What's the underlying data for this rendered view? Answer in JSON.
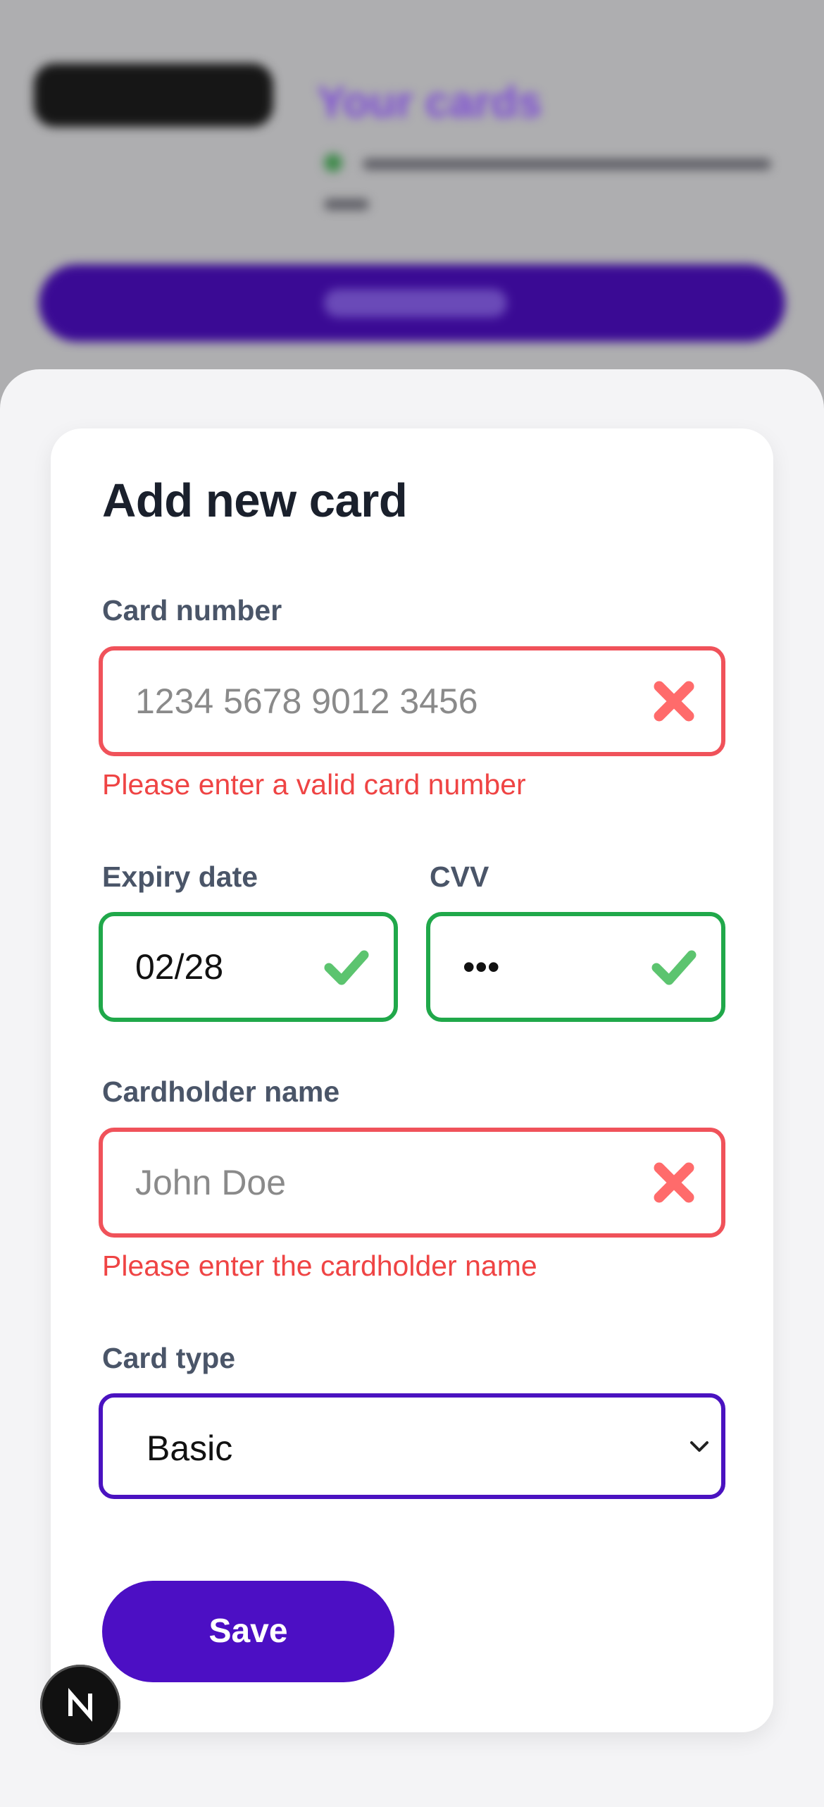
{
  "background": {
    "title": "Your cards"
  },
  "form": {
    "title": "Add new card",
    "card_number": {
      "label": "Card number",
      "placeholder": "1234 5678 9012 3456",
      "value": "",
      "status": "invalid",
      "error": "Please enter a valid card number"
    },
    "expiry": {
      "label": "Expiry date",
      "value": "02/28",
      "status": "valid"
    },
    "cvv": {
      "label": "CVV",
      "value": "•••",
      "status": "valid"
    },
    "cardholder": {
      "label": "Cardholder name",
      "placeholder": "John Doe",
      "value": "",
      "status": "invalid",
      "error": "Please enter the cardholder name"
    },
    "card_type": {
      "label": "Card type",
      "selected": "Basic"
    },
    "save_label": "Save"
  },
  "colors": {
    "invalid": "#f0525a",
    "valid": "#20a84a",
    "accent": "#4c0fc4",
    "error_text": "#ef4444"
  },
  "icons": {
    "invalid": "x-icon",
    "valid": "check-icon",
    "select": "chevron-down-icon",
    "badge": "next-logo-icon"
  }
}
